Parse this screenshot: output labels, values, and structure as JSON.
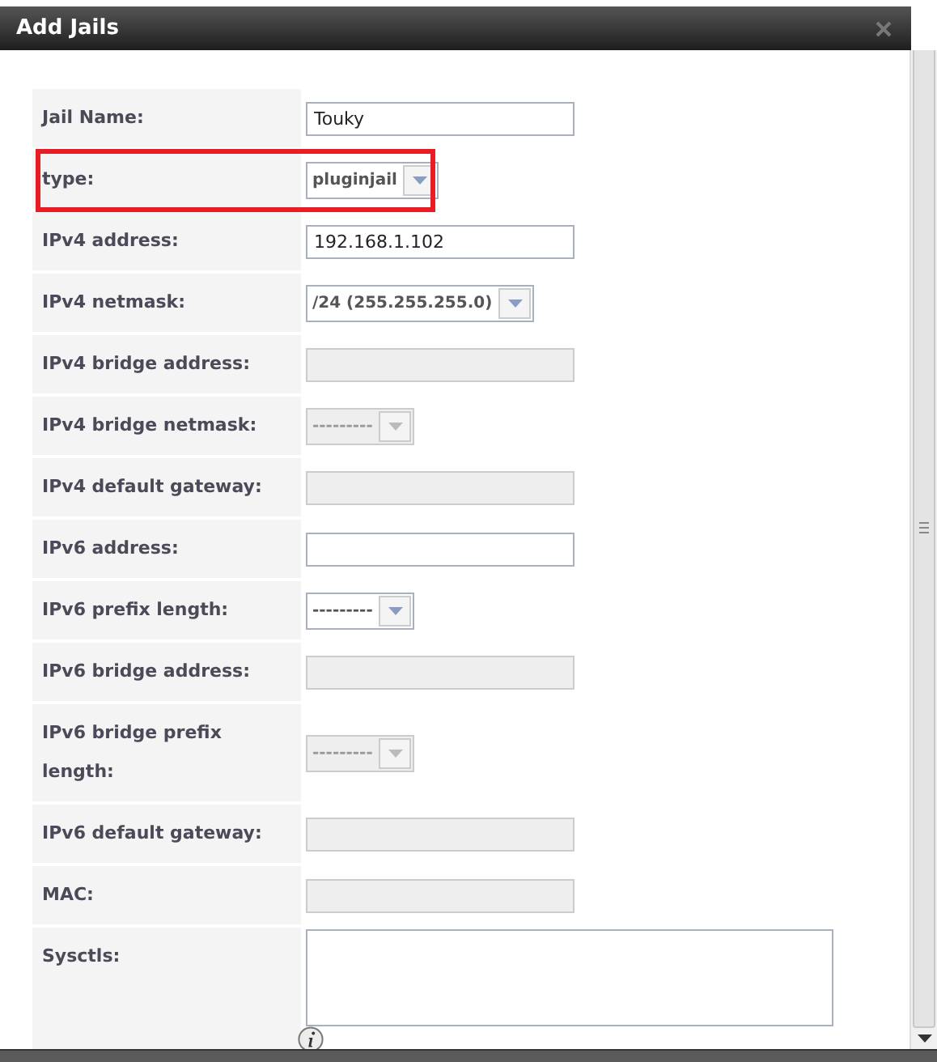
{
  "window": {
    "title": "Add Jails"
  },
  "fields": [
    {
      "label": "Jail Name:",
      "kind": "text",
      "value": "Touky",
      "disabled": false,
      "highlighted": false
    },
    {
      "label": "type:",
      "kind": "select",
      "value": "pluginjail",
      "disabled": false,
      "highlighted": true
    },
    {
      "label": "IPv4 address:",
      "kind": "text",
      "value": "192.168.1.102",
      "disabled": false,
      "highlighted": false
    },
    {
      "label": "IPv4 netmask:",
      "kind": "select",
      "value": "/24 (255.255.255.0)",
      "disabled": false,
      "highlighted": false
    },
    {
      "label": "IPv4 bridge address:",
      "kind": "text",
      "disabled": true,
      "highlighted": false
    },
    {
      "label": "IPv4 bridge netmask:",
      "kind": "select",
      "value": "---------",
      "disabled": true,
      "highlighted": false
    },
    {
      "label": "IPv4 default gateway:",
      "kind": "text",
      "disabled": true,
      "highlighted": false
    },
    {
      "label": "IPv6 address:",
      "kind": "text",
      "disabled": false,
      "highlighted": false
    },
    {
      "label": "IPv6 prefix length:",
      "kind": "select",
      "value": "---------",
      "disabled": false,
      "highlighted": false
    },
    {
      "label": "IPv6 bridge address:",
      "kind": "text",
      "disabled": true,
      "highlighted": false
    },
    {
      "label": "IPv6 bridge prefix length:",
      "kind": "select",
      "value": "---------",
      "disabled": true,
      "highlighted": false
    },
    {
      "label": "IPv6 default gateway:",
      "kind": "text",
      "disabled": true,
      "highlighted": false
    },
    {
      "label": "MAC:",
      "kind": "text",
      "disabled": true,
      "highlighted": false
    },
    {
      "label": "Sysctls:",
      "kind": "textarea",
      "disabled": false,
      "highlighted": false
    }
  ]
}
